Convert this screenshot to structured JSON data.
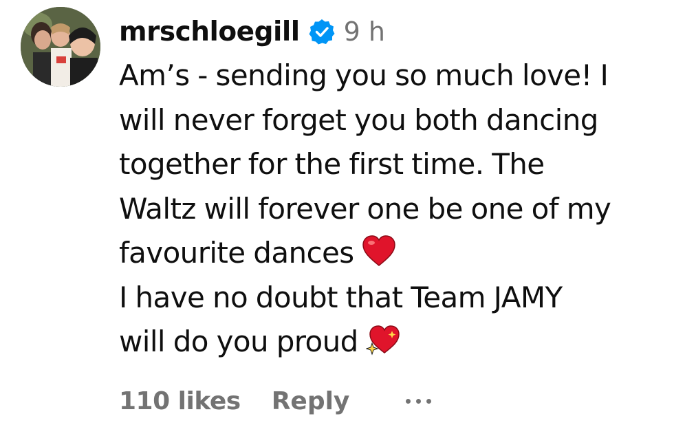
{
  "comment": {
    "username": "mrschloegill",
    "verified_icon": "verified-badge-icon",
    "time": "9 h",
    "lines": [
      "Am’s - sending you so much love! I",
      "will never forget you both dancing",
      "together for the first time. The",
      "Waltz will forever one be one of my",
      "favourite dances",
      "I have no doubt that Team JAMY",
      "will do you proud"
    ],
    "emoji_1": "red-heart-icon",
    "emoji_2": "sparkling-heart-icon",
    "likes": "110 likes",
    "reply_label": "Reply",
    "more_icon": "more-options-icon"
  },
  "colors": {
    "text": "#0f0f0f",
    "muted": "#737373",
    "verified": "#0095f6",
    "heart": "#e0142b"
  }
}
